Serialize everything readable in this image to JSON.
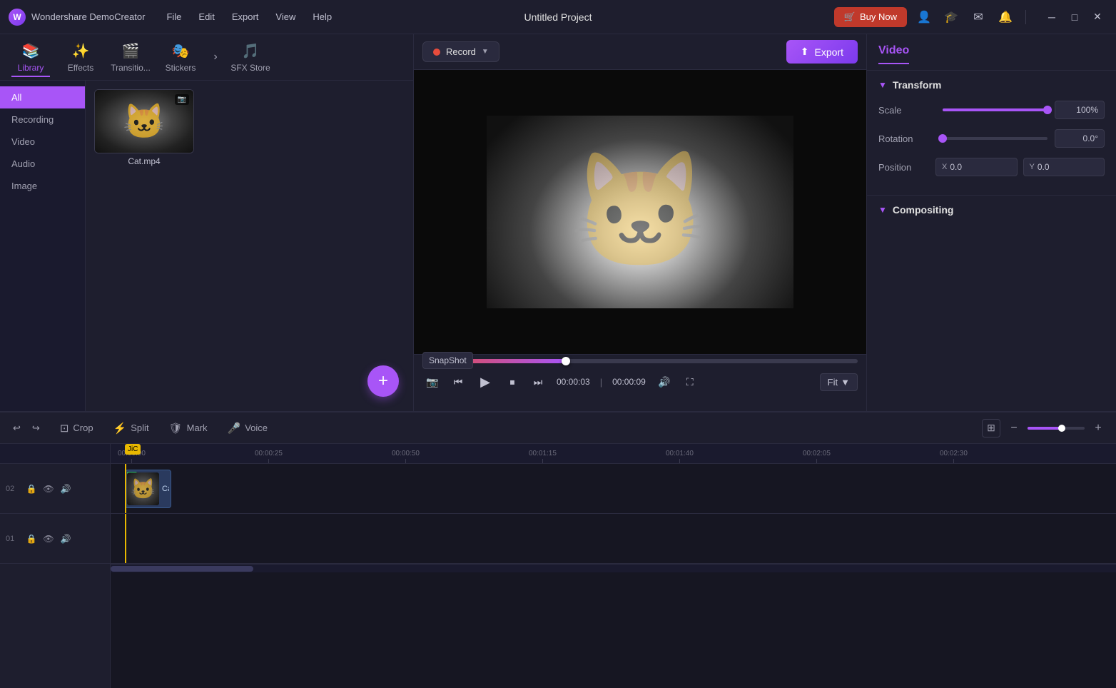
{
  "app": {
    "name": "Wondershare DemoCreator",
    "project_title": "Untitled Project"
  },
  "menu": {
    "items": [
      "File",
      "Edit",
      "Export",
      "View",
      "Help"
    ]
  },
  "titlebar": {
    "buy_now": "Buy Now",
    "export_label": "Export"
  },
  "toolbar": {
    "tabs": [
      {
        "id": "library",
        "label": "Library",
        "icon": "📚"
      },
      {
        "id": "effects",
        "label": "Effects",
        "icon": "✨"
      },
      {
        "id": "transitions",
        "label": "Transitio...",
        "icon": "🎬"
      },
      {
        "id": "stickers",
        "label": "Stickers",
        "icon": "🎭"
      },
      {
        "id": "sfx",
        "label": "SFX Store",
        "icon": "🎵"
      }
    ]
  },
  "sidebar_nav": {
    "items": [
      "All",
      "Recording",
      "Video",
      "Audio",
      "Image"
    ]
  },
  "media": {
    "items": [
      {
        "name": "Cat.mp4",
        "type": "video"
      }
    ]
  },
  "preview": {
    "record_label": "Record",
    "fit_label": "Fit",
    "time_current": "00:00:03",
    "time_total": "00:00:09",
    "snapshot_tooltip": "SnapShot"
  },
  "right_panel": {
    "title": "Video",
    "transform": {
      "section_label": "Transform",
      "scale_label": "Scale",
      "scale_value": "100%",
      "rotation_label": "Rotation",
      "rotation_value": "0.0°",
      "position_label": "Position",
      "position_x_label": "X",
      "position_x_value": "0.0",
      "position_y_label": "Y",
      "position_y_value": "0.0"
    },
    "compositing": {
      "section_label": "Compositing"
    }
  },
  "timeline": {
    "tools": [
      {
        "label": "Crop",
        "icon": "⊡"
      },
      {
        "label": "Split",
        "icon": "⚡"
      },
      {
        "label": "Mark",
        "icon": "🛡"
      },
      {
        "label": "Voice",
        "icon": "🎤"
      }
    ],
    "ruler_marks": [
      "00:00:00",
      "00:00:25",
      "00:00:50",
      "00:01:15",
      "00:01:40",
      "00:02:05",
      "00:02:30"
    ],
    "tracks": [
      {
        "id": "02",
        "clip": "Cat.m"
      },
      {
        "id": "01"
      }
    ],
    "playhead_time": "JiC"
  }
}
